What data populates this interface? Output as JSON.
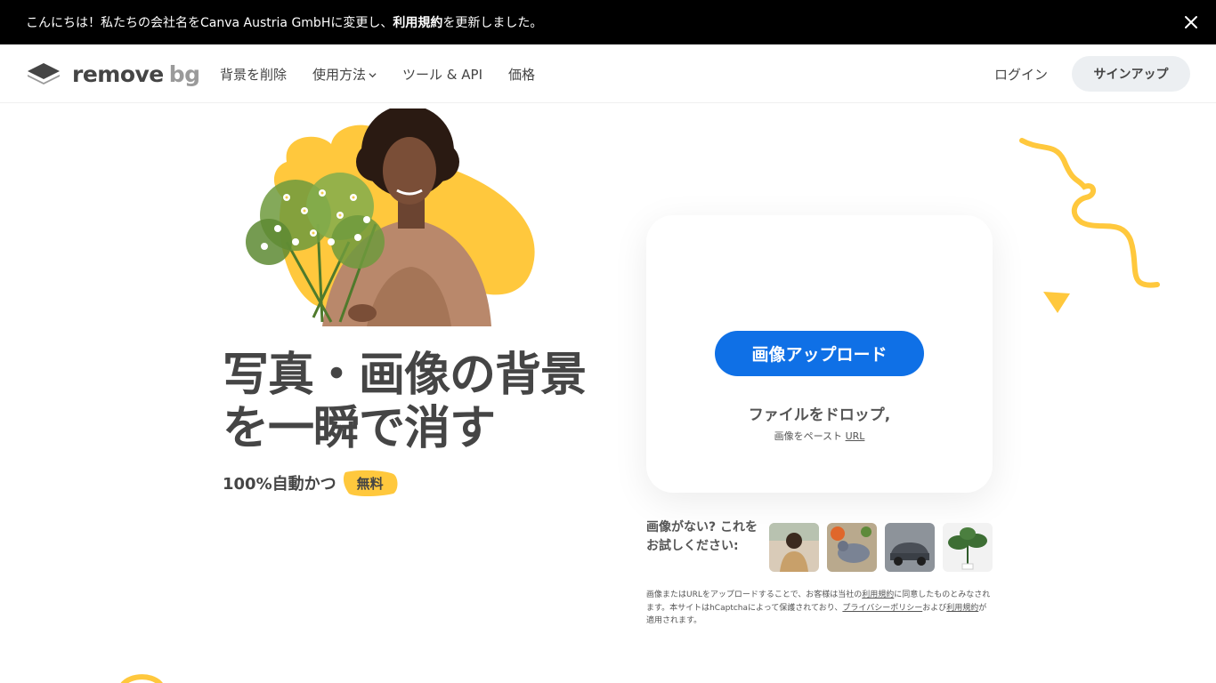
{
  "announcement": {
    "text_before": "こんにちは！私たちの会社名をCanva Austria GmbHに変更し、",
    "text_bold": "利用規約",
    "text_after": "を更新しました。",
    "close_icon": "close-icon"
  },
  "nav": {
    "logo_word_1": "remove",
    "logo_word_2": "bg",
    "links": [
      "背景を削除",
      "使用方法",
      "ツール & API",
      "価格"
    ],
    "login": "ログイン",
    "signup": "サインアップ"
  },
  "hero": {
    "headline_line1": "写真・画像の背景",
    "headline_line2": "を一瞬で消す",
    "sub_text": "100%自動かつ",
    "badge": "無料"
  },
  "upload": {
    "button": "画像アップロード",
    "drop_text": "ファイルをドロップ,",
    "paste_text": "画像をペースト",
    "paste_url": "URL"
  },
  "samples": {
    "prompt": "画像がない? これをお試しください:",
    "items": [
      "person",
      "pigeon",
      "car",
      "plant"
    ]
  },
  "legal": {
    "part1": "画像またはURLをアップロードすることで、お客様は当社の",
    "link1": "利用規約",
    "part2": "に同意したものとみなされます。本サイトはhCaptchaによって保護されており、",
    "link2": "プライバシーポリシー",
    "part3": "および",
    "link3": "利用規約",
    "part4": "が適用されます。"
  },
  "colors": {
    "accent_blue": "#0f70e6",
    "brand_yellow": "#ffc83d",
    "text_dark": "#454545"
  }
}
